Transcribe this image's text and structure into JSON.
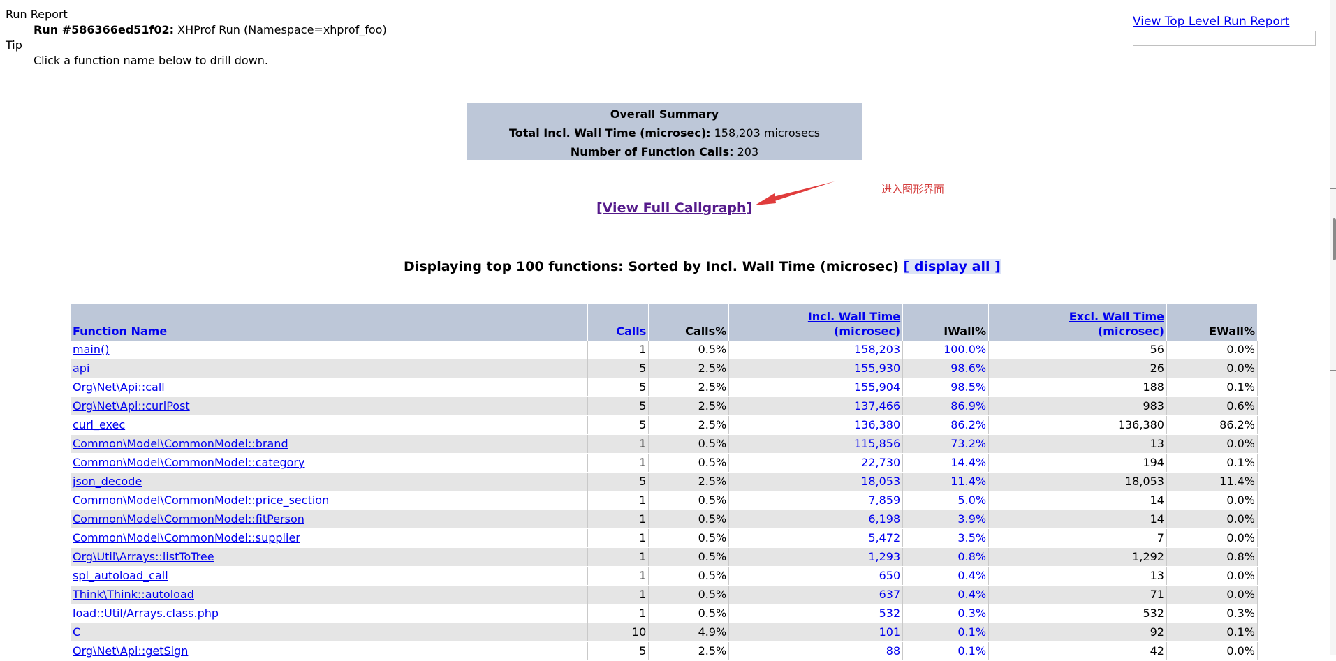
{
  "header": {
    "run_report_label": "Run Report",
    "run_id_label": "Run #586366ed51f02:",
    "run_desc": "XHProf Run (Namespace=xhprof_foo)",
    "tip_label": "Tip",
    "tip_text": "Click a function name below to drill down."
  },
  "top_right": {
    "link": "View Top Level Run Report",
    "input_value": ""
  },
  "summary": {
    "title": "Overall Summary",
    "wall_label": "Total Incl. Wall Time (microsec):",
    "wall_value": "158,203 microsecs",
    "calls_label": "Number of Function Calls:",
    "calls_value": "203"
  },
  "callgraph_link": "[View Full Callgraph]",
  "annotation_text": "进入图形界面",
  "display": {
    "title": "Displaying top 100 functions: Sorted by Incl. Wall Time (microsec)",
    "display_all": "[ display all ]"
  },
  "table": {
    "headers": {
      "function_name": "Function Name",
      "calls": "Calls",
      "calls_pct": "Calls%",
      "incl_wall_1": "Incl. Wall Time",
      "incl_wall_2": "(microsec)",
      "iwall_pct": "IWall%",
      "excl_wall_1": "Excl. Wall Time",
      "excl_wall_2": "(microsec)",
      "ewall_pct": "EWall%"
    },
    "rows": [
      {
        "name": "main()",
        "calls": "1",
        "calls_pct": "0.5%",
        "incl": "158,203",
        "iwall": "100.0%",
        "excl": "56",
        "ewall": "0.0%"
      },
      {
        "name": "api",
        "calls": "5",
        "calls_pct": "2.5%",
        "incl": "155,930",
        "iwall": "98.6%",
        "excl": "26",
        "ewall": "0.0%"
      },
      {
        "name": "Org\\Net\\Api::call",
        "calls": "5",
        "calls_pct": "2.5%",
        "incl": "155,904",
        "iwall": "98.5%",
        "excl": "188",
        "ewall": "0.1%"
      },
      {
        "name": "Org\\Net\\Api::curlPost",
        "calls": "5",
        "calls_pct": "2.5%",
        "incl": "137,466",
        "iwall": "86.9%",
        "excl": "983",
        "ewall": "0.6%"
      },
      {
        "name": "curl_exec",
        "calls": "5",
        "calls_pct": "2.5%",
        "incl": "136,380",
        "iwall": "86.2%",
        "excl": "136,380",
        "ewall": "86.2%"
      },
      {
        "name": "Common\\Model\\CommonModel::brand",
        "calls": "1",
        "calls_pct": "0.5%",
        "incl": "115,856",
        "iwall": "73.2%",
        "excl": "13",
        "ewall": "0.0%"
      },
      {
        "name": "Common\\Model\\CommonModel::category",
        "calls": "1",
        "calls_pct": "0.5%",
        "incl": "22,730",
        "iwall": "14.4%",
        "excl": "194",
        "ewall": "0.1%"
      },
      {
        "name": "json_decode",
        "calls": "5",
        "calls_pct": "2.5%",
        "incl": "18,053",
        "iwall": "11.4%",
        "excl": "18,053",
        "ewall": "11.4%"
      },
      {
        "name": "Common\\Model\\CommonModel::price_section",
        "calls": "1",
        "calls_pct": "0.5%",
        "incl": "7,859",
        "iwall": "5.0%",
        "excl": "14",
        "ewall": "0.0%"
      },
      {
        "name": "Common\\Model\\CommonModel::fitPerson",
        "calls": "1",
        "calls_pct": "0.5%",
        "incl": "6,198",
        "iwall": "3.9%",
        "excl": "14",
        "ewall": "0.0%"
      },
      {
        "name": "Common\\Model\\CommonModel::supplier",
        "calls": "1",
        "calls_pct": "0.5%",
        "incl": "5,472",
        "iwall": "3.5%",
        "excl": "7",
        "ewall": "0.0%"
      },
      {
        "name": "Org\\Util\\Arrays::listToTree",
        "calls": "1",
        "calls_pct": "0.5%",
        "incl": "1,293",
        "iwall": "0.8%",
        "excl": "1,292",
        "ewall": "0.8%"
      },
      {
        "name": "spl_autoload_call",
        "calls": "1",
        "calls_pct": "0.5%",
        "incl": "650",
        "iwall": "0.4%",
        "excl": "13",
        "ewall": "0.0%"
      },
      {
        "name": "Think\\Think::autoload",
        "calls": "1",
        "calls_pct": "0.5%",
        "incl": "637",
        "iwall": "0.4%",
        "excl": "71",
        "ewall": "0.0%"
      },
      {
        "name": "load::Util/Arrays.class.php",
        "calls": "1",
        "calls_pct": "0.5%",
        "incl": "532",
        "iwall": "0.3%",
        "excl": "532",
        "ewall": "0.3%"
      },
      {
        "name": "C",
        "calls": "10",
        "calls_pct": "4.9%",
        "incl": "101",
        "iwall": "0.1%",
        "excl": "92",
        "ewall": "0.1%"
      },
      {
        "name": "Org\\Net\\Api::getSign",
        "calls": "5",
        "calls_pct": "2.5%",
        "incl": "88",
        "iwall": "0.1%",
        "excl": "42",
        "ewall": "0.0%"
      }
    ]
  }
}
